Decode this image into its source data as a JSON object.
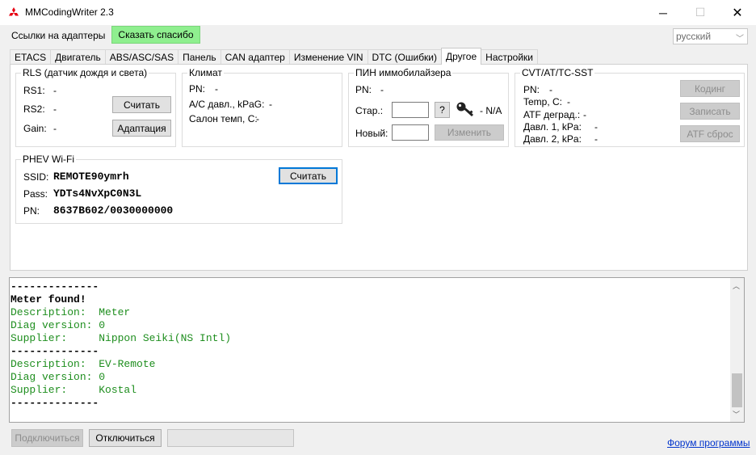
{
  "window": {
    "title": "MMCodingWriter 2.3",
    "minimize": "─",
    "maximize": "☐",
    "close": "✕"
  },
  "menu": {
    "adapters_link": "Ссылки на адаптеры",
    "thanks_button": "Сказать спасибо",
    "language": "русский"
  },
  "tabs": [
    {
      "label": "ETACS"
    },
    {
      "label": "Двигатель"
    },
    {
      "label": "ABS/ASC/SAS"
    },
    {
      "label": "Панель"
    },
    {
      "label": "CAN адаптер"
    },
    {
      "label": "Изменение VIN"
    },
    {
      "label": "DTC (Ошибки)"
    },
    {
      "label": "Другое",
      "active": true
    },
    {
      "label": "Настройки"
    }
  ],
  "rls": {
    "title": "RLS (датчик дождя и света)",
    "rs1_label": "RS1:",
    "rs1_value": "-",
    "rs2_label": "RS2:",
    "rs2_value": "-",
    "gain_label": "Gain:",
    "gain_value": "-",
    "read_button": "Считать",
    "adapt_button": "Адаптация"
  },
  "climate": {
    "title": "Климат",
    "pn_label": "PN:",
    "pn_value": "-",
    "ac_label": "A/C давл., kPaG:",
    "ac_value": "-",
    "cabin_label": "Салон темп, C:",
    "cabin_value": "-"
  },
  "immo": {
    "title": "ПИН иммобилайзера",
    "pn_label": "PN:",
    "pn_value": "-",
    "old_label": "Стар.:",
    "help_button": "?",
    "key_status": "- N/A",
    "new_label": "Новый:",
    "change_button": "Изменить"
  },
  "cvt": {
    "title": "CVT/AT/TC-SST",
    "pn_label": "PN:",
    "pn_value": "-",
    "temp_label": "Temp, C:",
    "temp_value": "-",
    "atf_label": "ATF деград.:",
    "atf_value": "-",
    "p1_label": "Давл. 1, kPa:",
    "p1_value": "-",
    "p2_label": "Давл. 2, kPa:",
    "p2_value": "-",
    "coding_button": "Кодинг",
    "write_button": "Записать",
    "atf_reset_button": "ATF сброс"
  },
  "phev": {
    "title": "PHEV Wi-Fi",
    "ssid_label": "SSID:",
    "ssid_value": "REMOTE90ymrh",
    "pass_label": "Pass:",
    "pass_value": "YDTs4NvXpC0N3L",
    "pn_label": "PN:",
    "pn_value": "8637B602/0030000000",
    "read_button": "Считать"
  },
  "log": [
    {
      "text": "--------------",
      "style": "black"
    },
    {
      "text": "Meter found!",
      "style": "black"
    },
    {
      "text": "Description:  Meter",
      "style": "green"
    },
    {
      "text": "Diag version: 0",
      "style": "green"
    },
    {
      "text": "Supplier:     Nippon Seiki(NS Intl)",
      "style": "green"
    },
    {
      "text": "--------------",
      "style": "black"
    },
    {
      "text": "Description:  EV-Remote",
      "style": "green"
    },
    {
      "text": "Diag version: 0",
      "style": "green"
    },
    {
      "text": "Supplier:     Kostal",
      "style": "green"
    },
    {
      "text": "--------------",
      "style": "black"
    }
  ],
  "bottom": {
    "connect_button": "Подключиться",
    "disconnect_button": "Отключиться",
    "forum_link": "Форум программы"
  },
  "colors": {
    "thanks_bg": "#8fef8f",
    "log_green": "#1e8e1e",
    "link_blue": "#0033cc",
    "focus_blue": "#0078d7",
    "logo_red": "#e60012"
  }
}
